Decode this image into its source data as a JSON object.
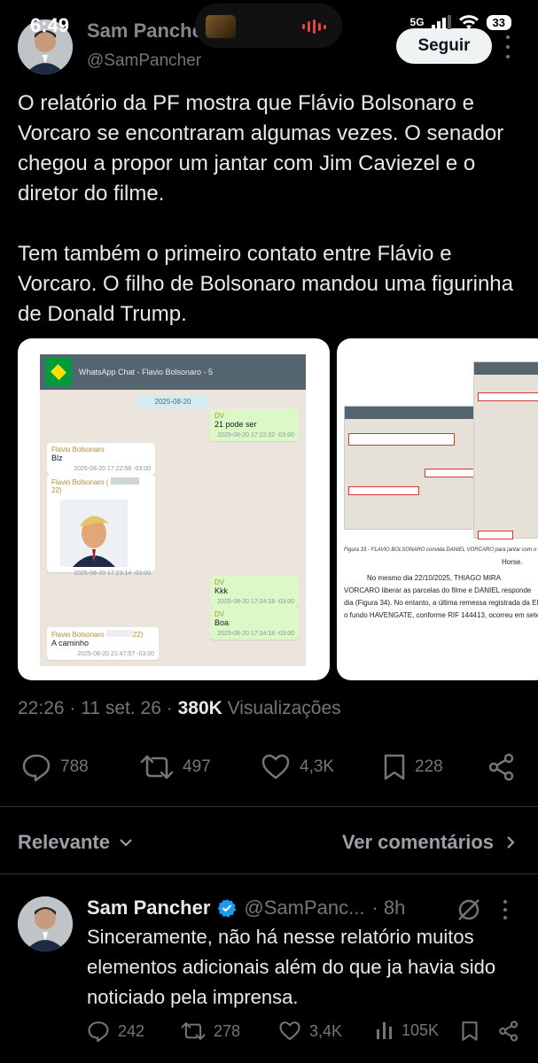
{
  "status_bar": {
    "time": "6:49",
    "network": "5G",
    "battery": "33"
  },
  "author": {
    "name": "Sam Pancher",
    "handle": "@SamPancher",
    "follow_label": "Seguir"
  },
  "tweet": {
    "paragraphs": [
      "O relatório da PF mostra que Flávio Bolsonaro e Vorcaro se encontraram algumas vezes. O senador chegou a propor um jantar com Jim Caviezel e o diretor do filme.",
      "Tem também o primeiro contato entre Flávio e Vorcaro. O filho de Bolsonaro mandou uma figurinha de Donald Trump."
    ],
    "time": "22:26",
    "date": "11 set. 26",
    "views": "380K",
    "views_label": "Visualizações",
    "replies": "788",
    "retweets": "497",
    "likes": "4,3K",
    "bookmarks": "228"
  },
  "media1": {
    "chat_title": "WhatsApp Chat - Flavio Bolsonaro - 5",
    "date_chip": "2025-08-20",
    "messages": [
      {
        "text": "21 pode ser",
        "sender": "DV",
        "ts": "2025-08-20 17:22:32 -03:00"
      },
      {
        "text": "Blz",
        "sender": "Flavio Bolsonaro",
        "ts": "2025-08-20 17:22:58 -03:00"
      },
      {
        "sender": "Flavio Bolsonaro (",
        "ts": "2025-08-20 17:23:14 -03:00",
        "tail": "22)"
      },
      {
        "text": "Kkk",
        "sender": "DV",
        "ts": "2025-08-20 17:24:18 -03:00"
      },
      {
        "text": "Boa",
        "sender": "DV",
        "ts": "2025-08-20 17:24:18 -03:00"
      },
      {
        "text": "A caminho",
        "sender": "Flavio Bolsonaro",
        "ts": "2025-08-20 21:47:57 -03:00",
        "tail": "22)"
      }
    ]
  },
  "media2": {
    "figure_caption": "Figura 33 - FLAVIO BOLSONARO convida DANIEL VORCARO para jantar com o",
    "lines": [
      "Horse.",
      "No mesmo dia 22/10/2025, THIAGO MIRA",
      "VORCARO liberar as parcelas do filme e DANIEL responde",
      "dia (Figura 34). No entanto, a última remessa registrada da EN",
      "o fundo HAVENGATE, conforme RIF 144413, ocorreu em sete"
    ]
  },
  "sort_label": "Relevante",
  "view_replies_label": "Ver comentários",
  "reply": {
    "name": "Sam Pancher",
    "handle": "@SamPanc...",
    "age": "· 8h",
    "text": "Sinceramente, não há nesse relatório muitos elementos adicionais além do que ja havia sido noticiado pela imprensa.",
    "replies": "242",
    "retweets": "278",
    "likes": "3,4K",
    "views": "105K"
  },
  "colors": {
    "background": "#000000",
    "verified": "#1d9bf0",
    "muted": "#71767b"
  }
}
